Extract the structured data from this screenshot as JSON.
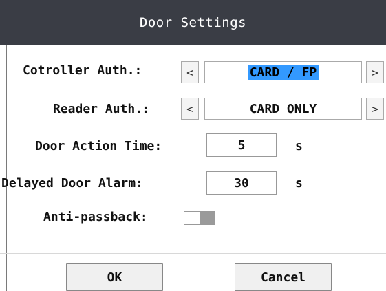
{
  "dialog": {
    "title": "Door Settings"
  },
  "fields": {
    "controller_auth": {
      "label": "Cotroller Auth.:",
      "value": "CARD / FP",
      "prev": "<",
      "next": ">"
    },
    "reader_auth": {
      "label": "Reader Auth.:",
      "value": "CARD ONLY",
      "prev": "<",
      "next": ">"
    },
    "door_action_time": {
      "label": "Door Action Time:",
      "value": "5",
      "unit": "s"
    },
    "delayed_door_alarm": {
      "label": "Delayed Door Alarm:",
      "value": "30",
      "unit": "s"
    },
    "anti_passback": {
      "label": "Anti-passback:",
      "enabled": false
    }
  },
  "buttons": {
    "ok": "OK",
    "cancel": "Cancel"
  },
  "colors": {
    "title_bar": "#3a3d45",
    "selection": "#3399ff",
    "toggle_knob": "#9a9a9a"
  }
}
